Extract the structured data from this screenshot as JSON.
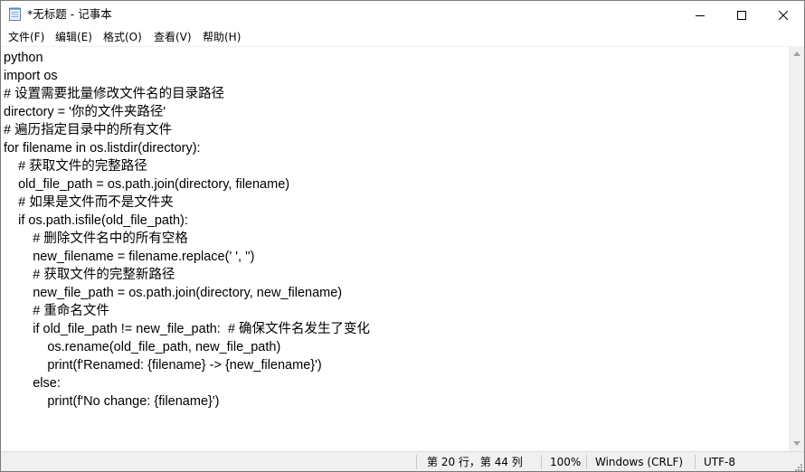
{
  "window": {
    "title": "*无标题 - 记事本",
    "icon": "notepad-icon"
  },
  "controls": {
    "minimize_icon": "minimize-icon",
    "maximize_icon": "maximize-icon",
    "close_icon": "close-icon"
  },
  "menu": [
    {
      "label": "文件(F)"
    },
    {
      "label": "编辑(E)"
    },
    {
      "label": "格式(O)"
    },
    {
      "label": "查看(V)"
    },
    {
      "label": "帮助(H)"
    }
  ],
  "editor": {
    "lines": [
      "python",
      "import os",
      "# 设置需要批量修改文件名的目录路径",
      "directory = '你的文件夹路径'",
      "# 遍历指定目录中的所有文件",
      "for filename in os.listdir(directory):",
      "    # 获取文件的完整路径",
      "    old_file_path = os.path.join(directory, filename)",
      "    # 如果是文件而不是文件夹",
      "    if os.path.isfile(old_file_path):",
      "        # 删除文件名中的所有空格",
      "        new_filename = filename.replace(' ', '')",
      "        # 获取文件的完整新路径",
      "        new_file_path = os.path.join(directory, new_filename)",
      "        # 重命名文件",
      "        if old_file_path != new_file_path:  # 确保文件名发生了变化",
      "            os.rename(old_file_path, new_file_path)",
      "            print(f'Renamed: {filename} -> {new_filename}')",
      "        else:",
      "            print(f'No change: {filename}')"
    ]
  },
  "status": {
    "position": "第 20 行，第 44 列",
    "zoom": "100%",
    "line_ending": "Windows (CRLF)",
    "encoding": "UTF-8"
  }
}
